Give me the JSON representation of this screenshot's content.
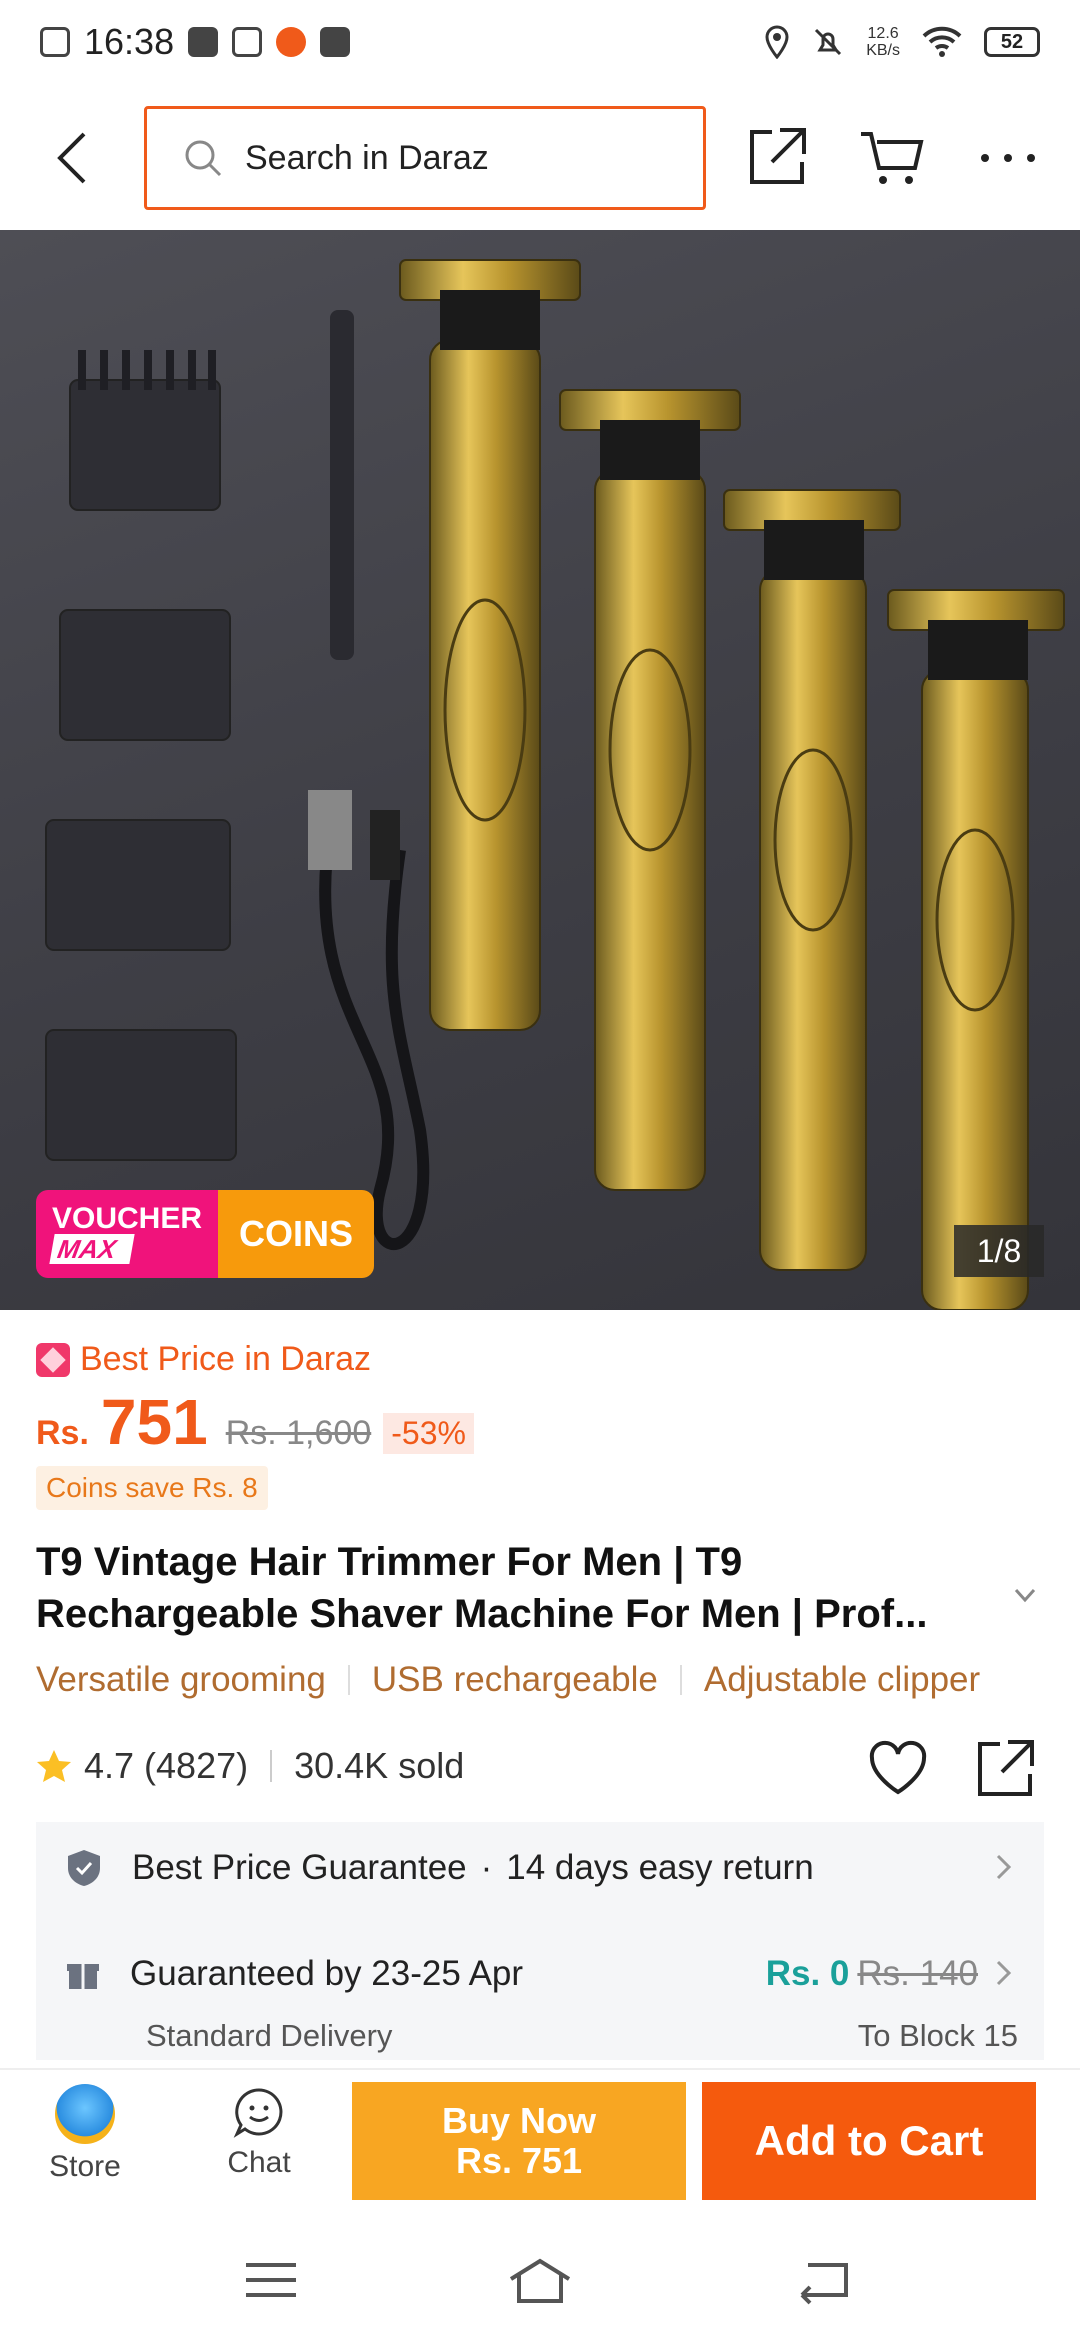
{
  "status_bar": {
    "time": "16:38",
    "network_speed_value": "12.6",
    "network_speed_unit": "KB/s",
    "battery": "52"
  },
  "header": {
    "search_placeholder": "Search in Daraz"
  },
  "gallery": {
    "counter": "1/8",
    "voucher_label": "VOUCHER",
    "voucher_max": "MAX",
    "coins_label": "COINS"
  },
  "pricing": {
    "best_price_label": "Best Price in Daraz",
    "currency": "Rs.",
    "price": "751",
    "original_price": "Rs. 1,600",
    "discount": "-53%",
    "coins_save": "Coins save Rs. 8"
  },
  "product": {
    "title": "T9 Vintage Hair Trimmer For Men | T9 Rechargeable Shaver Machine For Men | Prof...",
    "tags": [
      "Versatile grooming",
      "USB rechargeable",
      "Adjustable clipper"
    ],
    "rating": "4.7",
    "rating_count": "(4827)",
    "sold": "30.4K sold"
  },
  "services": {
    "guarantee": "Best Price Guarantee",
    "returns": "14 days easy return",
    "delivery_guarantee": "Guaranteed by 23-25 Apr",
    "delivery_type": "Standard Delivery",
    "delivery_price": "Rs. 0",
    "delivery_price_old": "Rs. 140",
    "delivery_location": "To Block 15"
  },
  "bottom_bar": {
    "store_label": "Store",
    "chat_label": "Chat",
    "buy_now_label": "Buy Now",
    "buy_now_price": "Rs. 751",
    "add_to_cart_label": "Add to Cart"
  },
  "colors": {
    "brand_orange": "#f05a1a",
    "buy_now": "#f8a622",
    "add_to_cart": "#f55a0d",
    "voucher_pink": "#f0137b",
    "free_delivery_teal": "#1aa09a"
  },
  "icons": [
    "back-arrow-icon",
    "search-icon",
    "share-icon",
    "cart-icon",
    "more-icon",
    "star-icon",
    "heart-icon",
    "shield-icon",
    "gift-icon",
    "chat-icon",
    "store-icon"
  ]
}
